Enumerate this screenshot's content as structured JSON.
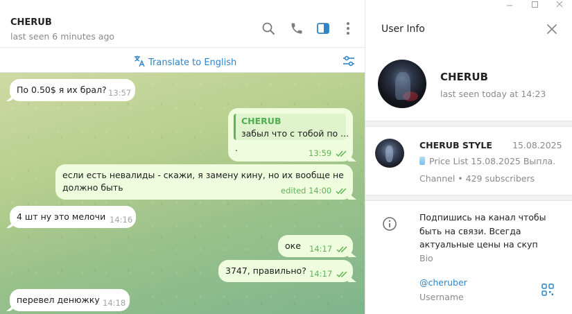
{
  "chat": {
    "title": "CHERUB",
    "status": "last seen 6 minutes ago",
    "header_icons": [
      "search-icon",
      "phone-icon",
      "sidebar-toggle-icon",
      "more-vertical-icon"
    ],
    "translate_label": "Translate to English",
    "messages": [
      {
        "direction": "in",
        "text": "По 0.50$ я их брал?",
        "time": "13:57"
      },
      {
        "direction": "out",
        "reply": {
          "name": "CHERUB",
          "text": "забыл что с тобой по ..."
        },
        "text": ".",
        "time": "13:59",
        "read": true
      },
      {
        "direction": "out",
        "lines": [
          "если есть невалиды - скажи, я замену кину, но их вообще не",
          "должно быть"
        ],
        "time": "edited 14:00",
        "read": true
      },
      {
        "direction": "in",
        "text": "4 шт ну это мелочи",
        "time": "14:16"
      },
      {
        "direction": "out",
        "text": "оке",
        "time": "14:17",
        "read": true
      },
      {
        "direction": "out",
        "text": "3747, правильно?",
        "time": "14:17",
        "read": true
      },
      {
        "direction": "in",
        "text": "перевел денюжку",
        "time": "14:18"
      }
    ]
  },
  "info": {
    "title": "User Info",
    "name": "CHERUB",
    "seen": "last seen today at 14:23",
    "channel": {
      "name": "CHERUB STYLE",
      "date": "15.08.2025",
      "preview": "Price List 15.08.2025  Выпла...",
      "subscribers": "Channel • 429 subscribers"
    },
    "bio": "Подпишись на канал чтобы быть на связи. Всегда актуальные цены на скуп",
    "bio_label": "Bio",
    "username": "@cheruber",
    "username_label": "Username"
  },
  "colors": {
    "accent": "#2d84c9",
    "outgoing_bubble": "#effdde",
    "incoming_bubble": "#ffffff",
    "read_check": "#5eb356",
    "reply_accent": "#4fae4e"
  }
}
